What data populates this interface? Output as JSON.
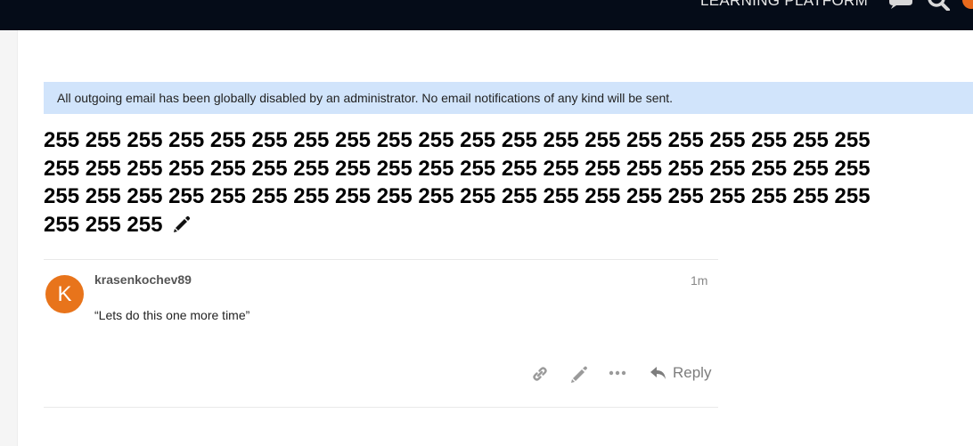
{
  "header": {
    "brand": "LEARNING PLATFORM",
    "icons": [
      "chat-icon",
      "search-icon",
      "user-avatar"
    ]
  },
  "notice": {
    "text": "All outgoing email has been globally disabled by an administrator. No email notifications of any kind will be sent."
  },
  "topic": {
    "title": "255 255 255 255 255 255 255 255 255 255 255 255 255 255 255 255 255 255 255 255 255 255 255 255 255 255 255 255 255 255 255 255 255 255 255 255 255 255 255 255 255 255 255 255 255 255 255 255 255 255 255 255 255 255 255 255 255 255 255 255 255 255 255",
    "edit_icon": "pencil-icon"
  },
  "post": {
    "avatar_letter": "K",
    "avatar_color": "#e8741b",
    "username": "krasenkochev89",
    "time": "1m",
    "body": "“Lets do this one more time”",
    "actions": {
      "icons": [
        "link-icon",
        "pencil-icon",
        "more-icon"
      ],
      "reply_label": "Reply"
    }
  },
  "colors": {
    "header_bg": "#050c18",
    "notice_bg": "#d1e4fb",
    "accent": "#e8741b"
  }
}
